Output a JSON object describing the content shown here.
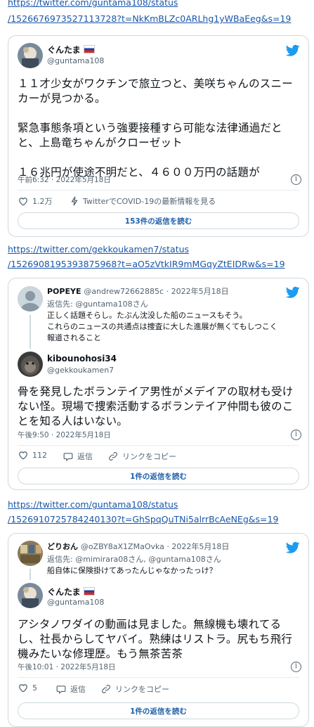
{
  "link1": {
    "line1": "https://twitter.com/guntama108/status",
    "line2": "/1526676973527113728?t=NkKmBLZc0ARLhg1yWBaEeg&s=19"
  },
  "tweet1": {
    "user_name": "ぐんたま",
    "user_handle": "@guntama108",
    "body_lines": [
      "１１才少女がワクチンで旅立つと、美咲ちゃんのスニー",
      "カーが見つかる。",
      "",
      "緊急事態条項という強要接種すら可能な法律通過だと",
      "と、上島竜ちゃんがクローゼット",
      "",
      "１６兆円が使途不明だと、４６００万円の話題が"
    ],
    "timestamp": "午前6:32 · 2022年5月18日",
    "likes": "1.2万",
    "covid_link": "TwitterでCOVID-19の最新情報を見る",
    "read_replies": "153件の返信を読む"
  },
  "link2": {
    "line1": "https://twitter.com/gekkoukamen7/status",
    "line2": "/1526908195393875968?t=aO5zVtkIR9mMGqyZtEIDRw&s=19"
  },
  "tweet2": {
    "parent_name": "POPEYE",
    "parent_handle": "@andrew72662885c · 2022年5月18日",
    "parent_reply_to": "返信先: @guntama108さん",
    "parent_lines": [
      "正しく話題そらし。たぶん沈没した船のニュースもそう。",
      "これらのニュースの共通点は捜査に大した進展が無くてもしつこく",
      "報道されること"
    ],
    "user_name": "kibounohosi34",
    "user_handle": "@gekkoukamen7",
    "body_lines": [
      "骨を発見したボランテイア男性がメデイアの取材も受け",
      "ない怪。現場で捜索活動するボランテイア仲間も彼のこ",
      "とを知る人はいない。"
    ],
    "timestamp": "午後9:50 · 2022年5月18日",
    "likes": "112",
    "reply_label": "返信",
    "copy_link": "リンクをコピー",
    "read_replies": "1件の返信を読む"
  },
  "link3": {
    "line1": "https://twitter.com/guntama108/status",
    "line2": "/1526910725784240130?t=GhSpqQuTNi5alrrBcAeNEg&s=19"
  },
  "tweet3": {
    "parent_name": "どりおん",
    "parent_handle": "@oZBY8aX1ZMaOvka · 2022年5月18日",
    "parent_reply_to": "返信先: @mimirara08さん, @guntama108さん",
    "parent_lines": [
      "船自体に保険掛けてあったんじゃなかったっけ？"
    ],
    "user_name": "ぐんたま",
    "user_handle": "@guntama108",
    "body_lines": [
      "アシタノワダイの動画は見ました。無線機も壊れてる",
      "し、社長からしてヤバイ。熟練はリストラ。尻もち飛行",
      "機みたいな修理歴。もう無茶苦茶"
    ],
    "timestamp": "午後10:01 · 2022年5月18日",
    "likes": "5",
    "reply_label": "返信",
    "copy_link": "リンクをコピー",
    "read_replies": "1件の返信を読む"
  },
  "colors": {
    "twitter_blue": "#1d9bf0",
    "link": "#1a57a8",
    "heart": "#536471"
  }
}
